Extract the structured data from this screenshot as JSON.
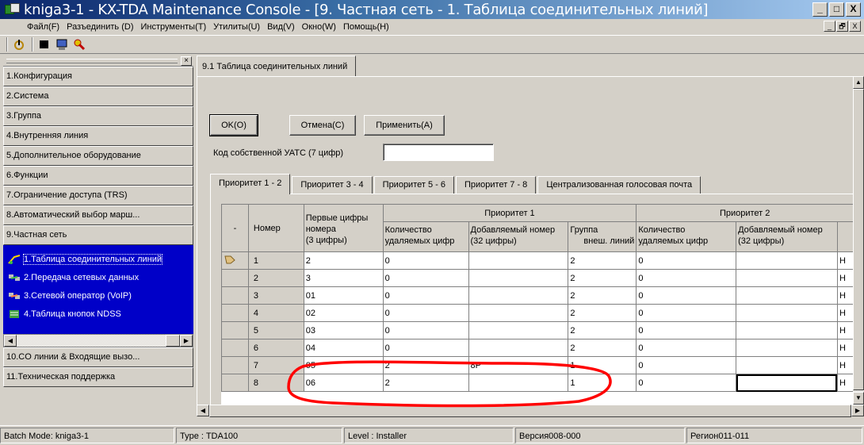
{
  "window": {
    "title": "kniga3-1 - KX-TDA Maintenance Console - [9. Частная сеть - 1. Таблица соединительных линий]",
    "min_btn": "_",
    "max_btn": "□",
    "close_btn": "X",
    "mdi_min": "_",
    "mdi_restore": "🗗",
    "mdi_close": "X"
  },
  "menu": [
    "Файл(F)",
    "Разъединить (D)",
    "Инструменты(T)",
    "Утилиты(U)",
    "Вид(V)",
    "Окно(W)",
    "Помощь(H)"
  ],
  "toolbar": {
    "icons": [
      "connect-icon",
      "disconnect-icon",
      "program-icon",
      "key-icon"
    ]
  },
  "nav": {
    "items_top": [
      "1.Конфигурация",
      "2.Система",
      "3.Группа",
      "4.Внутренняя линия",
      "5.Дополнительное оборудование",
      "6.Функции",
      "7.Ограничение доступа (TRS)",
      "8.Автоматический выбор марш...",
      "9.Частная сеть"
    ],
    "sub_items": [
      "1.Таблица соединительных линий",
      "2.Передача сетевых данных",
      "3.Сетевой оператор (VoIP)",
      "4.Таблица кнопок NDSS"
    ],
    "items_bottom": [
      "10.CO линии & Входящие вызо...",
      "11.Техническая поддержка"
    ]
  },
  "doc_tab": "9.1 Таблица соединительных линий",
  "buttons": {
    "ok": "OK(O)",
    "cancel": "Отмена(C)",
    "apply": "Применить(A)"
  },
  "pbx_code": {
    "label": "Код собственной УАТС (7 цифр)",
    "value": ""
  },
  "inner_tabs": [
    "Приоритет 1 - 2",
    "Приоритет 3 - 4",
    "Приоритет 5 - 6",
    "Приоритет 7 - 8",
    "Централизованная голосовая почта"
  ],
  "grid": {
    "headers": {
      "dash": "-",
      "number": "Номер",
      "first_digits_1": "Первые цифры",
      "first_digits_2": "номера",
      "first_digits_3": "(3 цифры)",
      "priority1": "Приоритет 1",
      "priority2": "Приоритет 2",
      "del_count_1": "Количество",
      "del_count_2": "удаляемых цифр",
      "added_num_1": "Добавляемый номер",
      "added_num_2": "(32 цифры)",
      "group_1": "Группа",
      "group_2": "внеш. линий",
      "del_count2_1": "Количество",
      "del_count2_2": "удаляемых цифр",
      "added_num2_1": "Добавляемый номер",
      "added_num2_2": "(32 цифры)"
    },
    "rows": [
      {
        "num": "1",
        "first": "2",
        "del": "0",
        "add": "",
        "group": "2",
        "del2": "0",
        "add2": "",
        "tail": "Н"
      },
      {
        "num": "2",
        "first": "3",
        "del": "0",
        "add": "",
        "group": "2",
        "del2": "0",
        "add2": "",
        "tail": "Н"
      },
      {
        "num": "3",
        "first": "01",
        "del": "0",
        "add": "",
        "group": "2",
        "del2": "0",
        "add2": "",
        "tail": "Н"
      },
      {
        "num": "4",
        "first": "02",
        "del": "0",
        "add": "",
        "group": "2",
        "del2": "0",
        "add2": "",
        "tail": "Н"
      },
      {
        "num": "5",
        "first": "03",
        "del": "0",
        "add": "",
        "group": "2",
        "del2": "0",
        "add2": "",
        "tail": "Н"
      },
      {
        "num": "6",
        "first": "04",
        "del": "0",
        "add": "",
        "group": "2",
        "del2": "0",
        "add2": "",
        "tail": "Н"
      },
      {
        "num": "7",
        "first": "05",
        "del": "2",
        "add": "8P",
        "group": "1",
        "del2": "0",
        "add2": "",
        "tail": "Н"
      },
      {
        "num": "8",
        "first": "06",
        "del": "2",
        "add": "",
        "group": "1",
        "del2": "0",
        "add2": "",
        "tail": "Н"
      }
    ]
  },
  "status": {
    "mode": "Batch Mode: kniga3-1",
    "type": "Type : TDA100",
    "level": "Level : Installer",
    "version": "Версия008-000",
    "region": "Регион011-011"
  },
  "colors": {
    "nav_selected_bg": "#0000c8",
    "annotation": "#ff0000"
  }
}
